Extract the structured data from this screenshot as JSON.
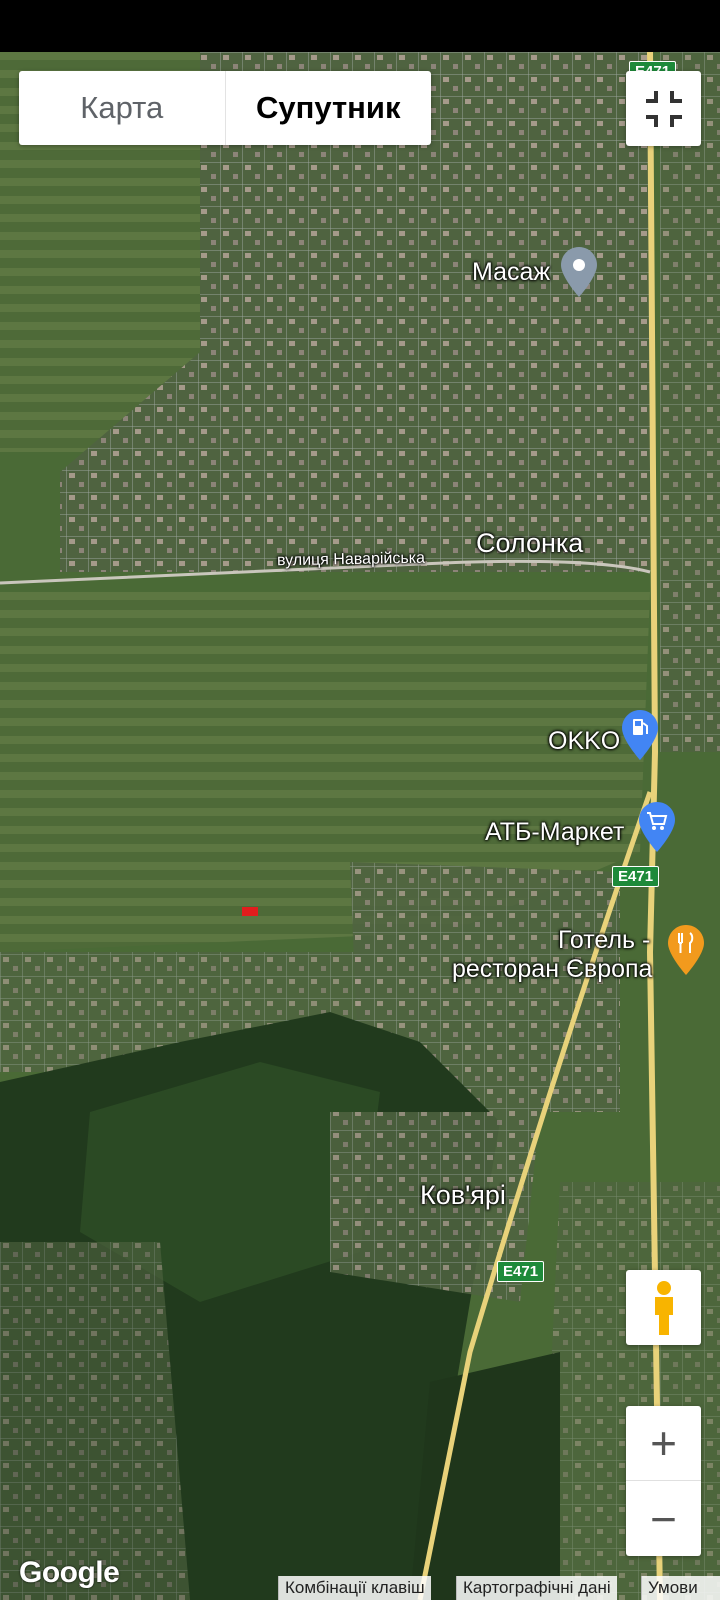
{
  "map_type_toggle": {
    "map_label": "Карта",
    "satellite_label": "Супутник",
    "selected": "Супутник"
  },
  "place_labels": {
    "village_1": "Солонка",
    "village_2": "Ков'ярі",
    "street": "вулиця Наварійська"
  },
  "pois": {
    "massage": "Масаж",
    "gas_station": "OKKO",
    "supermarket": "АТБ-Маркет",
    "hotel_line_1": "Готель -",
    "hotel_line_2": "ресторан Європа"
  },
  "road_shields": {
    "top": "E471",
    "middle": "E471",
    "bottom": "E471"
  },
  "zoom": {
    "in_label": "+",
    "out_label": "−"
  },
  "branding": {
    "logo": "Google"
  },
  "footer": {
    "shortcuts": "Комбінації клавіш",
    "map_data": "Картографічні дані",
    "terms": "Умови"
  },
  "icons": [
    "exit-fullscreen-icon",
    "pegman-icon",
    "pin-icon",
    "gas-station-icon",
    "shopping-cart-icon",
    "restaurant-icon"
  ],
  "colors": {
    "highway": "#e8d27a",
    "shield": "#1e8a3a",
    "pin_gray": "#8a9aab",
    "pin_blue": "#4285f4",
    "pin_orange": "#f29a1d"
  }
}
